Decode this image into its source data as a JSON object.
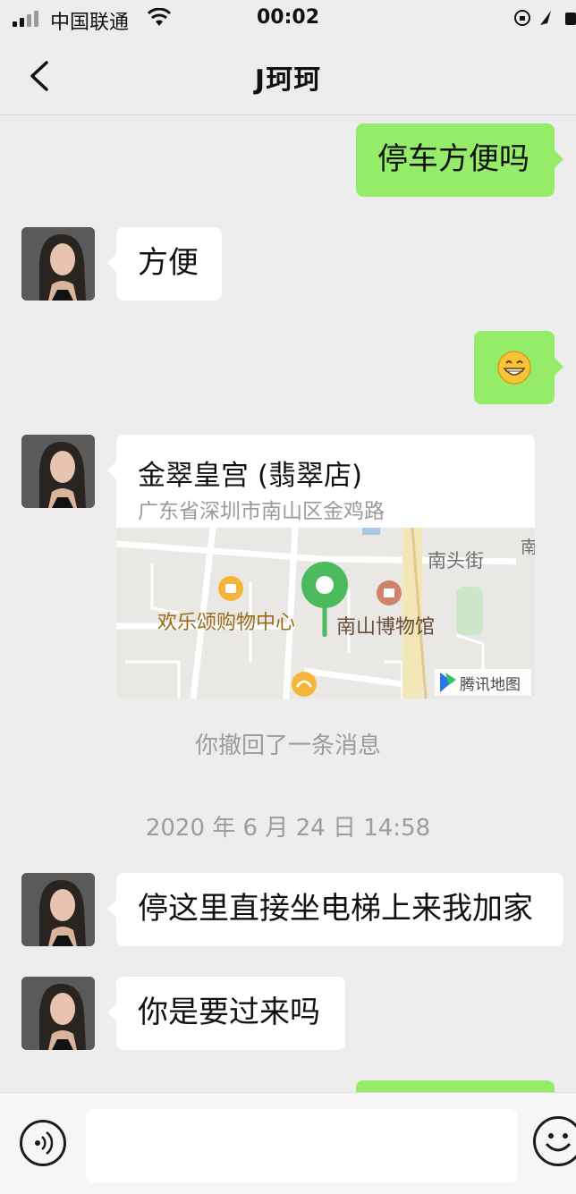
{
  "status_bar": {
    "carrier": "中国联通",
    "time": "00:02"
  },
  "nav": {
    "title": "J珂珂",
    "back_icon": "chevron-left-icon"
  },
  "messages": [
    {
      "side": "out",
      "type": "text",
      "text": "停车方便吗"
    },
    {
      "side": "in",
      "type": "text",
      "text": "方便"
    },
    {
      "side": "out",
      "type": "emoji",
      "text": "😁"
    },
    {
      "side": "in",
      "type": "location",
      "title": "金翠皇宫 (翡翠店)",
      "address": "广东省深圳市南山区金鸡路"
    },
    {
      "type": "system",
      "text": "你撤回了一条消息"
    },
    {
      "type": "timestamp",
      "text": "2020 年 6 月 24 日 14:58"
    },
    {
      "side": "in",
      "type": "text",
      "text": "停这里直接坐电梯上来我加家"
    },
    {
      "side": "in",
      "type": "text",
      "text": "你是要过来吗"
    }
  ],
  "map": {
    "labels": {
      "mall": "欢乐颂购物中心",
      "museum": "南山博物馆",
      "street": "南头街",
      "road": "南光路",
      "brand": "腾讯地图"
    },
    "pin_color": "#4cbb5e"
  },
  "input_bar": {
    "voice_icon": "voice-icon",
    "emoji_icon": "emoji-icon"
  },
  "colors": {
    "out_bubble": "#95ec69",
    "in_bubble": "#ffffff",
    "background": "#ededed"
  }
}
